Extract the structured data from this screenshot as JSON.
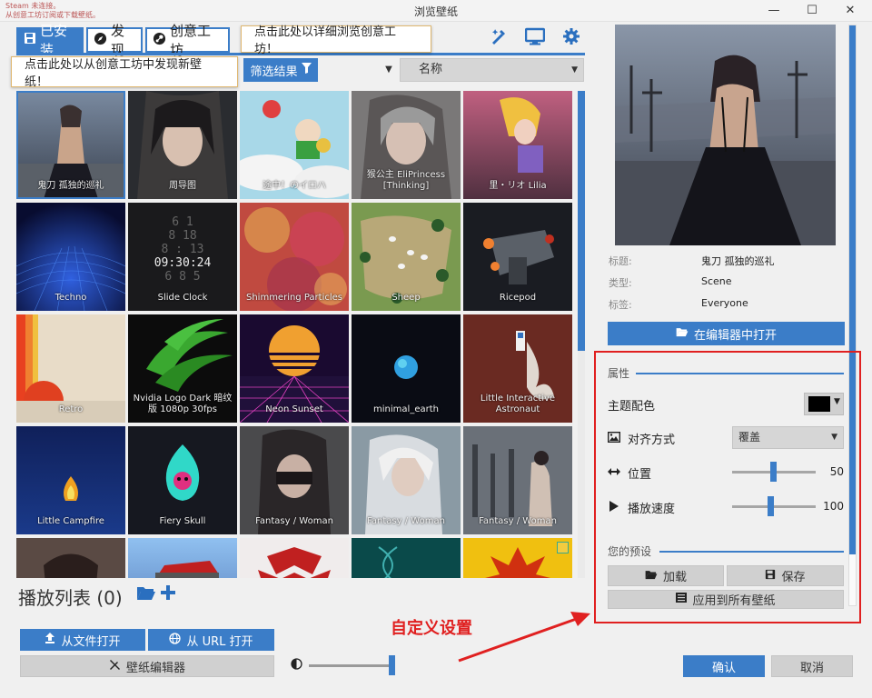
{
  "window": {
    "title": "浏览壁纸",
    "notice_line1": "Steam 未连接。",
    "notice_line2": "从创意工坊订阅或下载壁纸。",
    "minimize": "—",
    "maximize": "☐",
    "close": "✕"
  },
  "tabs": [
    {
      "label": "已安装",
      "icon": "save-icon"
    },
    {
      "label": "发现",
      "icon": "compass-icon"
    },
    {
      "label": "创意工坊",
      "icon": "steam-icon"
    }
  ],
  "tooltips": {
    "workshop": "点击此处以详细浏览创意工坊！",
    "discover": "点击此处以从创意工坊中发现新壁纸！"
  },
  "toolbar": {
    "icons": [
      "brush-icon",
      "monitor-icon",
      "gear-icon"
    ]
  },
  "filter": {
    "button_label": "筛选结果",
    "sort_value": "名称"
  },
  "wallpapers": [
    {
      "caption": "鬼刀 孤独的巡礼",
      "selected": true
    },
    {
      "caption": "周导图"
    },
    {
      "caption": "途中！のイロハ"
    },
    {
      "caption": "猴公主 EliPrincess [Thinking]"
    },
    {
      "caption": "里・リオ Lilia"
    },
    {
      "caption": "Techno"
    },
    {
      "caption": "Slide Clock",
      "clock": [
        "6  1",
        "8 18",
        "8 : 13",
        "09:30:24",
        "6  8 5"
      ]
    },
    {
      "caption": "Shimmering Particles"
    },
    {
      "caption": "Sheep"
    },
    {
      "caption": "Ricepod"
    },
    {
      "caption": "Retro"
    },
    {
      "caption": "Nvidia Logo Dark 暗纹版 1080p 30fps"
    },
    {
      "caption": "Neon Sunset"
    },
    {
      "caption": "minimal_earth"
    },
    {
      "caption": "Little Interactive Astronaut"
    },
    {
      "caption": "Little Campfire"
    },
    {
      "caption": "Fiery Skull"
    },
    {
      "caption": "Fantasy / Woman"
    },
    {
      "caption": "Fantasy / Woman"
    },
    {
      "caption": "Fantasy / Woman"
    },
    {
      "caption": ""
    },
    {
      "caption": ""
    },
    {
      "caption": ""
    },
    {
      "caption": ""
    },
    {
      "caption": ""
    }
  ],
  "playlist": {
    "label": "播放列表 (0)"
  },
  "buttons": {
    "open_file": "从文件打开",
    "open_url": "从 URL 打开",
    "editor": "壁纸编辑器",
    "open_in_editor": "在编辑器中打开",
    "load": "加载",
    "save": "保存",
    "apply_all": "应用到所有壁纸",
    "ok": "确认",
    "cancel": "取消"
  },
  "annotation": "自定义设置",
  "details": {
    "title_key": "标题:",
    "title_val": "鬼刀 孤独的巡礼",
    "type_key": "类型:",
    "type_val": "Scene",
    "tags_key": "标签:",
    "tags_val": "Everyone"
  },
  "properties": {
    "header": "属性",
    "scheme_color_label": "主题配色",
    "scheme_color": "#000000",
    "alignment_label": "对齐方式",
    "alignment_value": "覆盖",
    "position_label": "位置",
    "position_value": "50",
    "speed_label": "播放速度",
    "speed_value": "100"
  },
  "presets": {
    "header": "您的预设"
  },
  "colors": {
    "accent": "#3b7dc8",
    "annotation": "#e02020"
  }
}
